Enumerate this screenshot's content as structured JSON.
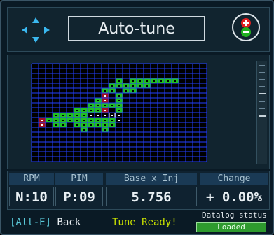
{
  "header": {
    "title": "Auto-tune",
    "dpad_icon": "dpad-arrows-icon",
    "plusminus_icon": "plus-minus-icon"
  },
  "map": {
    "cols": 25,
    "rows": 20,
    "colors": {
      "grid": "#2340ff",
      "background": "#000000",
      "cell_green": "#20c020",
      "cell_red": "#a01020",
      "cell_white_marker": "#ffffff"
    },
    "cells": [
      {
        "c": 14,
        "r": 3,
        "t": "g"
      },
      {
        "c": 15,
        "r": 3,
        "t": "g"
      },
      {
        "c": 16,
        "r": 3,
        "t": "g"
      },
      {
        "c": 17,
        "r": 3,
        "t": "g"
      },
      {
        "c": 18,
        "r": 3,
        "t": "g"
      },
      {
        "c": 19,
        "r": 3,
        "t": "g"
      },
      {
        "c": 20,
        "r": 3,
        "t": "g"
      },
      {
        "c": 12,
        "r": 3,
        "t": "g"
      },
      {
        "c": 11,
        "r": 4,
        "t": "g"
      },
      {
        "c": 12,
        "r": 4,
        "t": "g"
      },
      {
        "c": 13,
        "r": 4,
        "t": "g"
      },
      {
        "c": 14,
        "r": 4,
        "t": "g"
      },
      {
        "c": 15,
        "r": 4,
        "t": "g"
      },
      {
        "c": 16,
        "r": 4,
        "t": "g"
      },
      {
        "c": 10,
        "r": 5,
        "t": "g"
      },
      {
        "c": 11,
        "r": 5,
        "t": "g"
      },
      {
        "c": 13,
        "r": 5,
        "t": "g"
      },
      {
        "c": 14,
        "r": 5,
        "t": "g"
      },
      {
        "c": 10,
        "r": 6,
        "t": "r"
      },
      {
        "c": 12,
        "r": 6,
        "t": "g"
      },
      {
        "c": 9,
        "r": 7,
        "t": "g"
      },
      {
        "c": 10,
        "r": 7,
        "t": "r"
      },
      {
        "c": 12,
        "r": 7,
        "t": "g"
      },
      {
        "c": 8,
        "r": 8,
        "t": "g"
      },
      {
        "c": 9,
        "r": 8,
        "t": "g"
      },
      {
        "c": 10,
        "r": 8,
        "t": "g"
      },
      {
        "c": 11,
        "r": 8,
        "t": "g"
      },
      {
        "c": 12,
        "r": 8,
        "t": "g"
      },
      {
        "c": 6,
        "r": 9,
        "t": "g"
      },
      {
        "c": 7,
        "r": 9,
        "t": "g"
      },
      {
        "c": 8,
        "r": 9,
        "t": "g"
      },
      {
        "c": 9,
        "r": 9,
        "t": "g"
      },
      {
        "c": 10,
        "r": 9,
        "t": "r"
      },
      {
        "c": 12,
        "r": 9,
        "t": "g"
      },
      {
        "c": 3,
        "r": 10,
        "t": "g"
      },
      {
        "c": 4,
        "r": 10,
        "t": "g"
      },
      {
        "c": 5,
        "r": 10,
        "t": "g"
      },
      {
        "c": 6,
        "r": 10,
        "t": "g"
      },
      {
        "c": 7,
        "r": 10,
        "t": "g"
      },
      {
        "c": 8,
        "r": 10,
        "t": "w"
      },
      {
        "c": 9,
        "r": 10,
        "t": "w"
      },
      {
        "c": 10,
        "r": 10,
        "t": "w"
      },
      {
        "c": 11,
        "r": 10,
        "t": "sel"
      },
      {
        "c": 12,
        "r": 10,
        "t": "w"
      },
      {
        "c": 1,
        "r": 11,
        "t": "r"
      },
      {
        "c": 2,
        "r": 11,
        "t": "g"
      },
      {
        "c": 3,
        "r": 11,
        "t": "g"
      },
      {
        "c": 4,
        "r": 11,
        "t": "g"
      },
      {
        "c": 5,
        "r": 11,
        "t": "g"
      },
      {
        "c": 6,
        "r": 11,
        "t": "g"
      },
      {
        "c": 7,
        "r": 11,
        "t": "g"
      },
      {
        "c": 8,
        "r": 11,
        "t": "g"
      },
      {
        "c": 9,
        "r": 11,
        "t": "g"
      },
      {
        "c": 10,
        "r": 11,
        "t": "g"
      },
      {
        "c": 11,
        "r": 11,
        "t": "g"
      },
      {
        "c": 12,
        "r": 11,
        "t": "w"
      },
      {
        "c": 1,
        "r": 12,
        "t": "r"
      },
      {
        "c": 3,
        "r": 12,
        "t": "g"
      },
      {
        "c": 4,
        "r": 12,
        "t": "g"
      },
      {
        "c": 6,
        "r": 12,
        "t": "g"
      },
      {
        "c": 7,
        "r": 12,
        "t": "g"
      },
      {
        "c": 8,
        "r": 12,
        "t": "g"
      },
      {
        "c": 9,
        "r": 12,
        "t": "g"
      },
      {
        "c": 10,
        "r": 12,
        "t": "g"
      },
      {
        "c": 11,
        "r": 12,
        "t": "g"
      },
      {
        "c": 7,
        "r": 13,
        "t": "g"
      },
      {
        "c": 10,
        "r": 13,
        "t": "g"
      }
    ]
  },
  "info": {
    "rpm_label": "RPM",
    "pim_label": "PIM",
    "base_label": "Base x Inj",
    "change_label": "Change",
    "rpm_value": "N:10",
    "pim_value": "P:09",
    "base_value": "5.756",
    "change_value": "+ 0.00%"
  },
  "footer": {
    "back_key": "[Alt-E]",
    "back_label": "Back",
    "tune_status": "Tune Ready!",
    "datalog_label": "Datalog status",
    "datalog_value": "Loaded"
  },
  "colors": {
    "accent_cyan": "#5ac8d8",
    "ready_yellow": "#c8e000",
    "status_green": "#2e9a2e",
    "plus_red": "#e02020",
    "minus_green": "#20b020"
  }
}
